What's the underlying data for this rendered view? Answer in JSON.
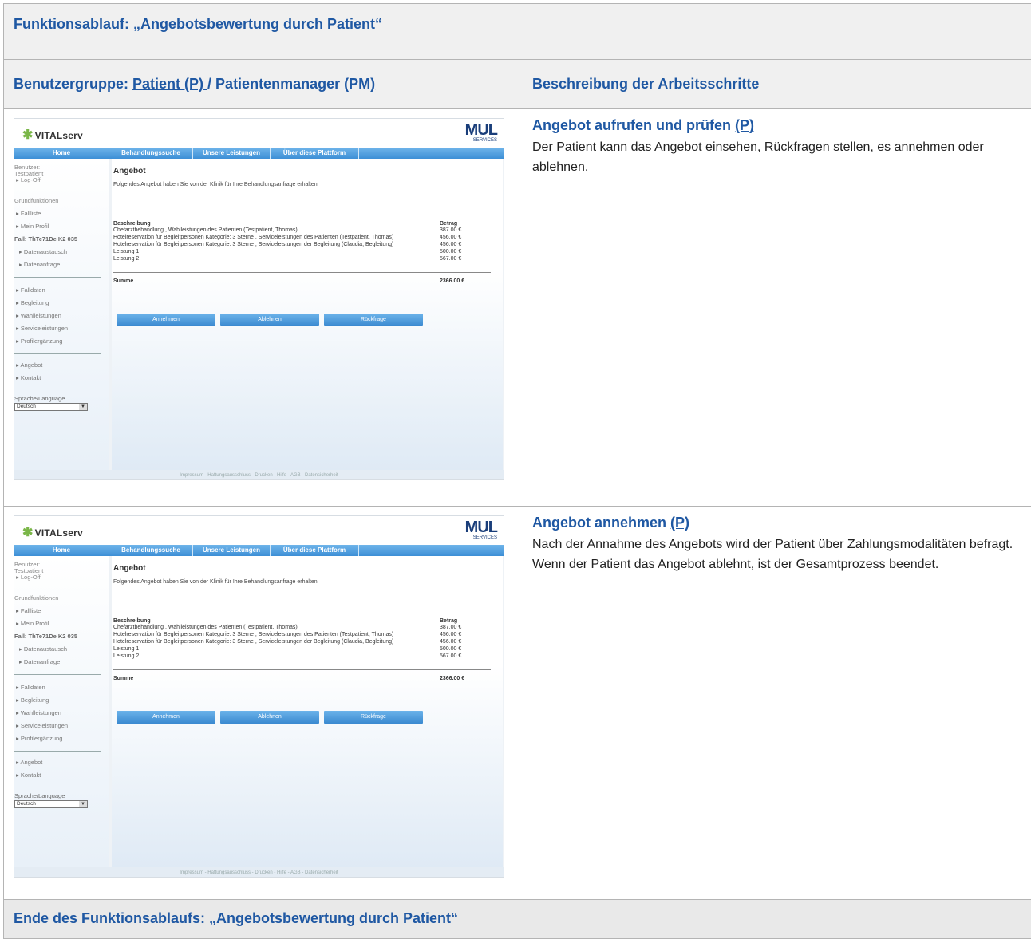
{
  "document": {
    "title": "Funktionsablauf: „Angebotsbewertung durch Patient“",
    "user_group_label": "Benutzergruppe:",
    "user_group_patient": "Patient (P) ",
    "user_group_slash": "/",
    "user_group_manager": " Patientenmanager (PM",
    "user_group_close": ")",
    "column_description": "Beschreibung der Arbeitsschritte",
    "steps": [
      {
        "title": "Angebot aufrufen und prüfen ",
        "role": "(P)",
        "body": "Der Patient kann das Angebot einsehen, Rückfragen stellen, es annehmen oder ablehnen."
      },
      {
        "title": "Angebot annehmen ",
        "role": "(P)",
        "body": "Nach der Annahme des Angebots wird der Patient über Zahlungsmodalitäten befragt. Wenn der Patient das Angebot ablehnt, ist der Gesamtprozess beendet."
      }
    ],
    "end_text": "Ende des Funktionsablaufs: „Angebotsbewertung durch Patient“"
  },
  "screen": {
    "logo": "VITALserv",
    "logo_right": "MUL",
    "logo_right_sub": "SERVICES",
    "nav": [
      "Home",
      "Behandlungssuche",
      "Unsere Leistungen",
      "Über diese Plattform"
    ],
    "sidebar": {
      "user_label": "Benutzer:",
      "user_name": "Testpatient",
      "logoff": "Log-Off",
      "section_basic": "Grundfunktionen",
      "fallliste": "Fallliste",
      "profil": "Mein Profil",
      "fall": "Fall: ThTe71De K2 035",
      "datenaustausch": "Datenaustausch",
      "datenanfrage": "Datenanfrage",
      "falldaten": "Falldaten",
      "begleitung": "Begleitung",
      "wahlleistungen": "Wahlleistungen",
      "serviceleistungen": "Serviceleistungen",
      "profilergaenzung": "Profilergänzung",
      "angebot": "Angebot",
      "kontakt": "Kontakt",
      "language_label": "Sprache/Language",
      "language_value": "Deutsch"
    },
    "main": {
      "heading": "Angebot",
      "intro": "Folgendes Angebot haben Sie von der Klinik für Ihre Behandlungsanfrage erhalten.",
      "col_desc": "Beschreibung",
      "col_amount": "Betrag",
      "rows": [
        {
          "desc": "Chefarztbehandlung , Wahlleistungen des Patienten (Testpatient, Thomas)",
          "amount": "387.00 €"
        },
        {
          "desc": "Hotelreservation für Begleitpersonen Kategorie: 3 Sterne , Serviceleistungen des Patienten (Testpatient, Thomas)",
          "amount": "456.00 €"
        },
        {
          "desc": "Hotelreservation für Begleitpersonen Kategorie: 3 Sterne , Serviceleistungen der Begleitung (Claudia, Begleitung)",
          "amount": "456.00 €"
        },
        {
          "desc": "Leistung 1",
          "amount": "500.00 €"
        },
        {
          "desc": "Leistung 2",
          "amount": "567.00 €"
        }
      ],
      "sum_label": "Summe",
      "sum_value": "2366.00 €",
      "btn_accept": "Annehmen",
      "btn_reject": "Ablehnen",
      "btn_query": "Rückfrage"
    },
    "footer": "Impressum  -  Haftungsausschluss  -  Drucken  -  Hilfe  -  AGB  -  Datensicherheit"
  }
}
